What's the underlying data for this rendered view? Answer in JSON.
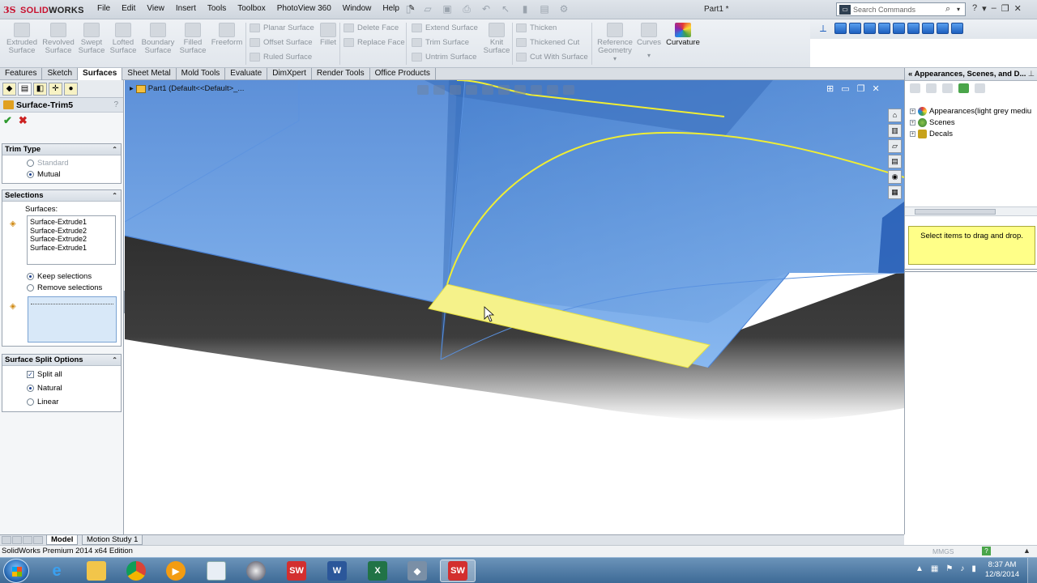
{
  "app": {
    "brand_ds": "3S",
    "brand_solid": "SOLID",
    "brand_works": "WORKS",
    "doc_title": "Part1 *"
  },
  "menu": [
    "File",
    "Edit",
    "View",
    "Insert",
    "Tools",
    "Toolbox",
    "PhotoView 360",
    "Window",
    "Help"
  ],
  "search": {
    "placeholder": "Search Commands"
  },
  "ribbon": {
    "big_buttons": [
      {
        "label": "Extruded\nSurface"
      },
      {
        "label": "Revolved\nSurface"
      },
      {
        "label": "Swept\nSurface"
      },
      {
        "label": "Lofted\nSurface"
      },
      {
        "label": "Boundary\nSurface"
      },
      {
        "label": "Filled\nSurface"
      },
      {
        "label": "Freeform"
      }
    ],
    "col1": [
      "Planar Surface",
      "Offset Surface",
      "Ruled Surface"
    ],
    "fillet": "Fillet",
    "col2": [
      "Delete Face",
      "Replace Face"
    ],
    "col3": [
      "Extend Surface",
      "Trim Surface",
      "Untrim Surface"
    ],
    "knit": "Knit\nSurface",
    "col4": [
      "Thicken",
      "Thickened Cut",
      "Cut With Surface"
    ],
    "ref_geom": "Reference\nGeometry",
    "curves": "Curves",
    "curvature": "Curvature"
  },
  "tabs": [
    {
      "label": "Features",
      "active": false
    },
    {
      "label": "Sketch",
      "active": false
    },
    {
      "label": "Surfaces",
      "active": true
    },
    {
      "label": "Sheet Metal",
      "active": false
    },
    {
      "label": "Mold Tools",
      "active": false
    },
    {
      "label": "Evaluate",
      "active": false
    },
    {
      "label": "DimXpert",
      "active": false
    },
    {
      "label": "Render Tools",
      "active": false
    },
    {
      "label": "Office Products",
      "active": false
    }
  ],
  "pm": {
    "title": "Surface-Trim5",
    "help": "?",
    "trim_type": {
      "header": "Trim Type",
      "standard": "Standard",
      "mutual": "Mutual"
    },
    "selections": {
      "header": "Selections",
      "surfaces_label": "Surfaces:",
      "surfaces": [
        "Surface-Extrude1",
        "Surface-Extrude2",
        "Surface-Extrude2",
        "Surface-Extrude1"
      ],
      "keep": "Keep selections",
      "remove": "Remove selections"
    },
    "split": {
      "header": "Surface Split Options",
      "split_all": "Split all",
      "natural": "Natural",
      "linear": "Linear"
    }
  },
  "viewport": {
    "tree_label": "Part1  (Default<<Default>_..."
  },
  "taskpane": {
    "title": "Appearances, Scenes, and D...",
    "tree": [
      "Appearances(light grey mediu",
      "Scenes",
      "Decals"
    ],
    "drag_hint": "Select items to drag and drop."
  },
  "bottom_tabs": [
    "Model",
    "Motion Study 1"
  ],
  "status": {
    "edition": "SolidWorks Premium 2014 x64 Edition",
    "units": "MMGS"
  },
  "taskbar": {
    "time": "8:37 AM",
    "date": "12/8/2014"
  },
  "colors": {
    "surface_blue": "#7fb0ea",
    "selected_yellow": "#f5f28a",
    "edge_yellow": "#f0ee33",
    "shadow": "#3c3c3c"
  }
}
